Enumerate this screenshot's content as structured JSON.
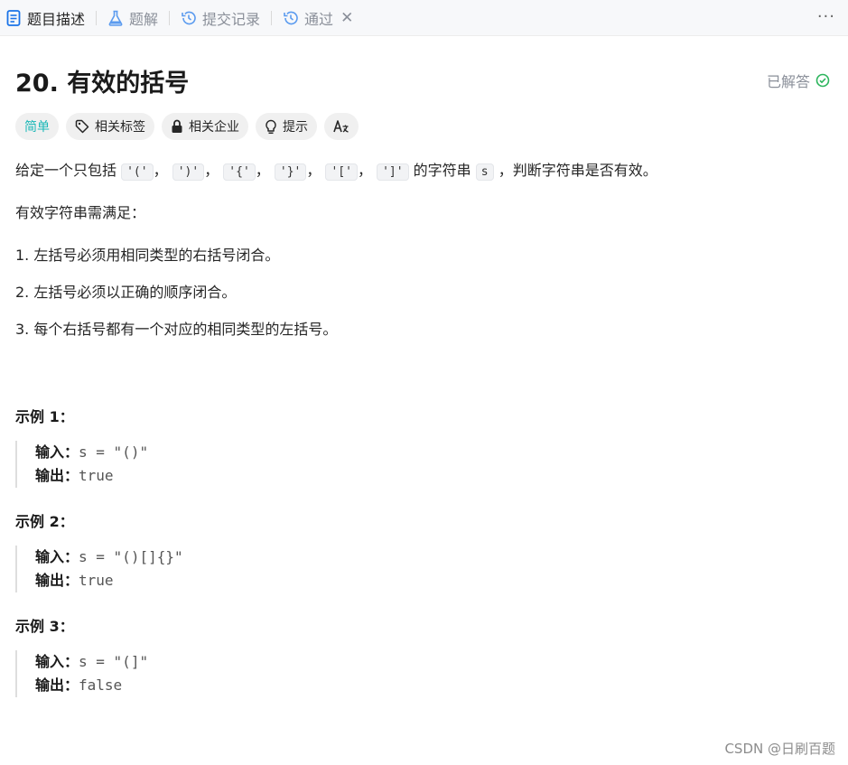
{
  "tabs": [
    {
      "label": "题目描述",
      "icon": "document-icon",
      "active": true
    },
    {
      "label": "题解",
      "icon": "flask-icon",
      "active": false
    },
    {
      "label": "提交记录",
      "icon": "history-icon",
      "active": false
    },
    {
      "label": "通过",
      "icon": "history-icon",
      "active": false
    }
  ],
  "tab_close": "✕",
  "more": "···",
  "problem": {
    "title": "20. 有效的括号",
    "status": "已解答",
    "accent_color": "#1cb8b8",
    "solved_color": "#2db55d"
  },
  "tags": [
    {
      "label": "简单",
      "icon": ""
    },
    {
      "label": "相关标签",
      "icon": "tag-icon"
    },
    {
      "label": "相关企业",
      "icon": "lock-icon"
    },
    {
      "label": "提示",
      "icon": "lightbulb-icon"
    },
    {
      "label": "",
      "icon": "translate-icon"
    }
  ],
  "description": {
    "intro_prefix": "给定一个只包括",
    "chars": [
      "'('",
      "')'",
      "'{'",
      "'}'",
      "'['",
      "']'"
    ],
    "sep": "，",
    "intro_mid": "的字符串",
    "var": "s",
    "intro_suffix": "，判断字符串是否有效。",
    "rule_heading": "有效字符串需满足：",
    "rules": [
      "1. 左括号必须用相同类型的右括号闭合。",
      "2. 左括号必须以正确的顺序闭合。",
      "3. 每个右括号都有一个对应的相同类型的左括号。"
    ]
  },
  "examples": [
    {
      "title": "示例 1：",
      "input_label": "输入：",
      "input": "s = \"()\"",
      "output_label": "输出：",
      "output": "true"
    },
    {
      "title": "示例 2：",
      "input_label": "输入：",
      "input": "s = \"()[]{}\"",
      "output_label": "输出：",
      "output": "true"
    },
    {
      "title": "示例 3：",
      "input_label": "输入：",
      "input": "s = \"(]\"",
      "output_label": "输出：",
      "output": "false"
    }
  ],
  "watermark": "CSDN @日刷百题"
}
